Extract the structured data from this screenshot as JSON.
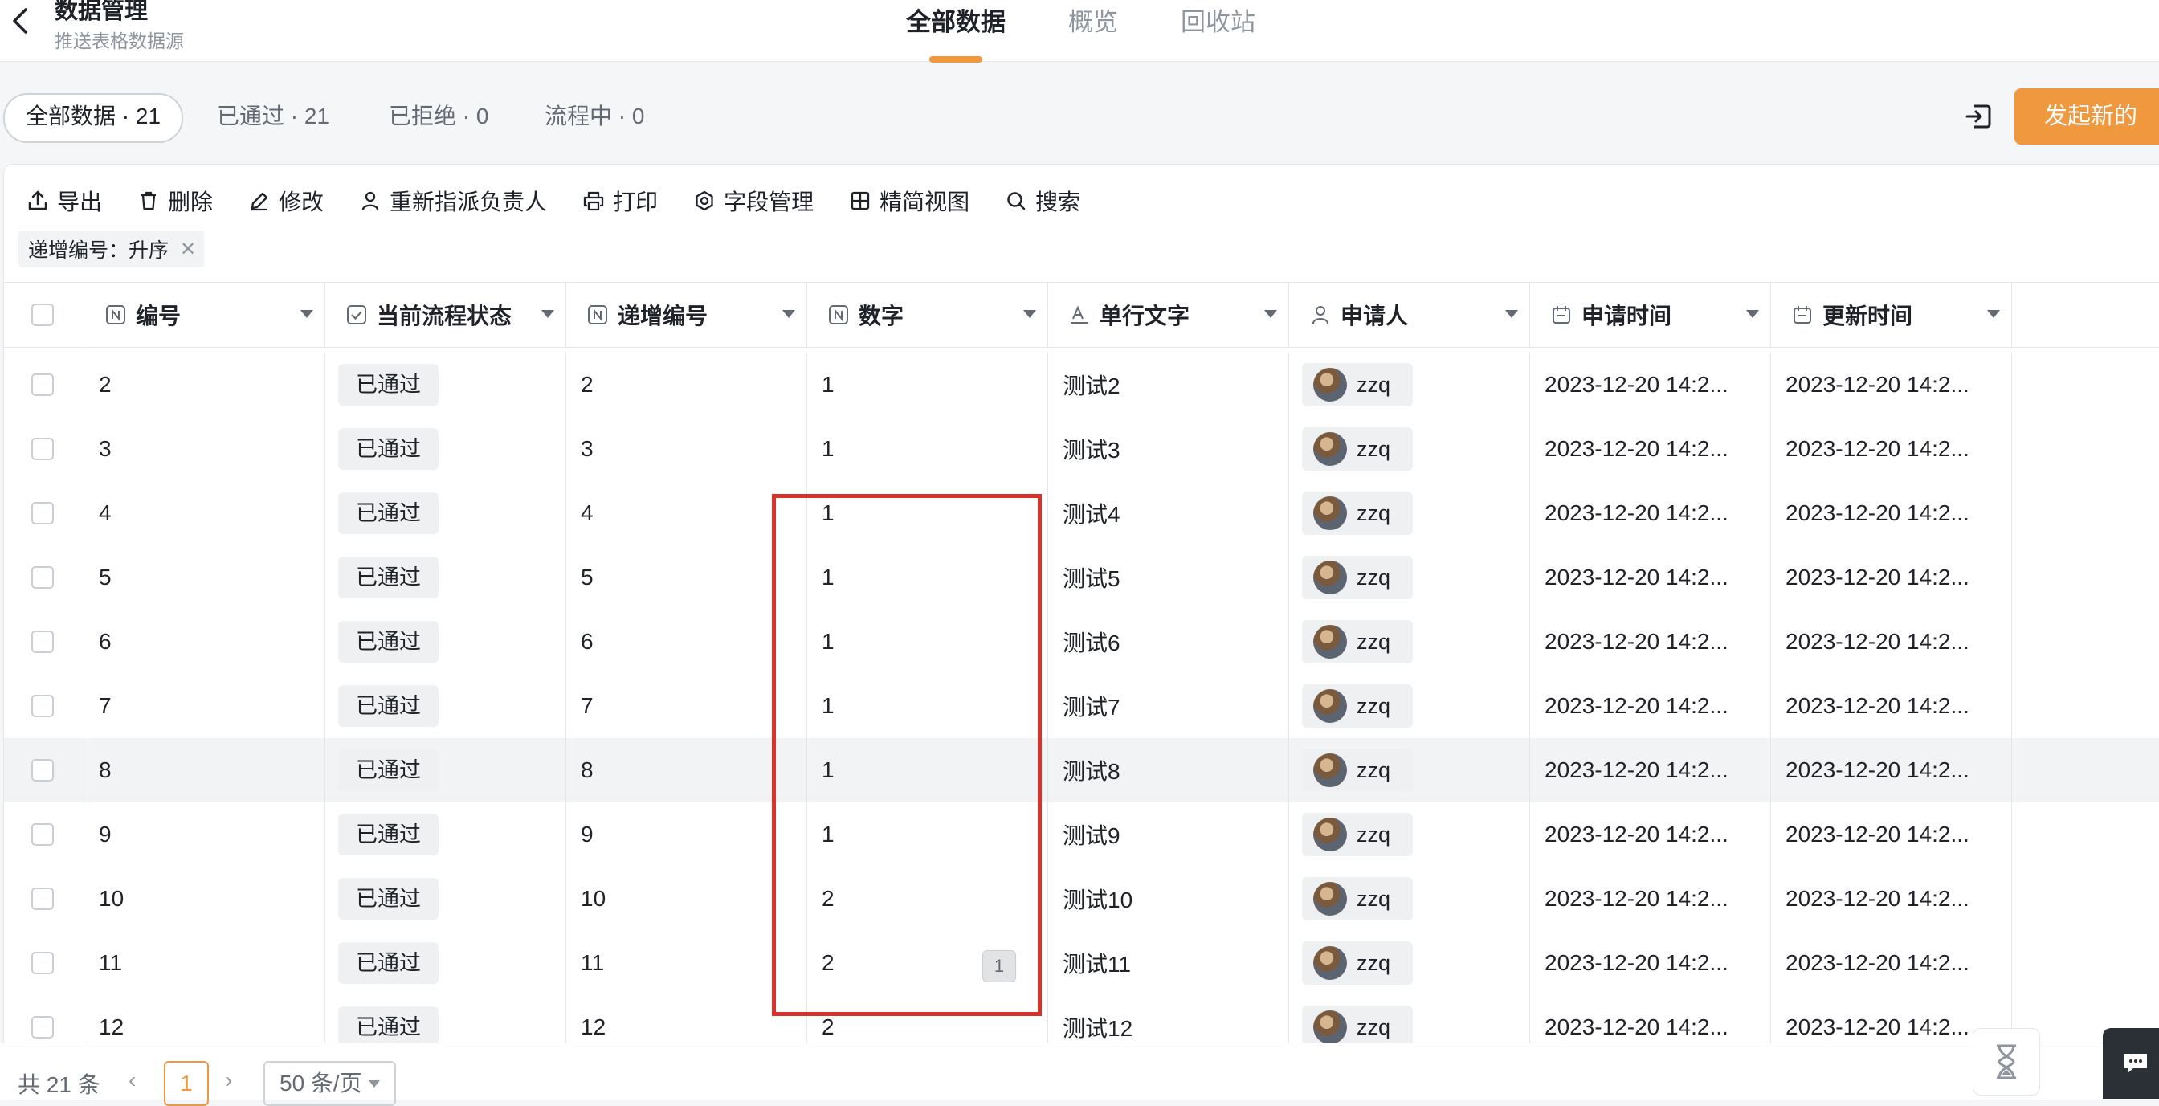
{
  "header": {
    "title": "数据管理",
    "subtitle": "推送表格数据源",
    "tabs": [
      {
        "label": "全部数据",
        "active": true
      },
      {
        "label": "概览",
        "active": false
      },
      {
        "label": "回收站",
        "active": false
      }
    ]
  },
  "filters": {
    "all": "全部数据 · 21",
    "approved": "已通过 · 21",
    "rejected": "已拒绝 · 0",
    "in_progress": "流程中 · 0"
  },
  "new_button": "发起新的",
  "toolbar": {
    "export": "导出",
    "delete": "删除",
    "edit": "修改",
    "reassign": "重新指派负责人",
    "print": "打印",
    "fields": "字段管理",
    "compact_view": "精简视图",
    "search": "搜索"
  },
  "sort_tag": "递增编号：升序",
  "columns": {
    "id": "编号",
    "status": "当前流程状态",
    "seq": "递增编号",
    "number": "数字",
    "text": "单行文字",
    "applicant": "申请人",
    "apply_time": "申请时间",
    "update_time": "更新时间"
  },
  "rows": [
    {
      "id": "2",
      "status": "已通过",
      "seq": "2",
      "number": "1",
      "text": "测试2",
      "applicant": "zzq",
      "apply_time": "2023-12-20 14:2...",
      "update_time": "2023-12-20 14:2..."
    },
    {
      "id": "3",
      "status": "已通过",
      "seq": "3",
      "number": "1",
      "text": "测试3",
      "applicant": "zzq",
      "apply_time": "2023-12-20 14:2...",
      "update_time": "2023-12-20 14:2..."
    },
    {
      "id": "4",
      "status": "已通过",
      "seq": "4",
      "number": "1",
      "text": "测试4",
      "applicant": "zzq",
      "apply_time": "2023-12-20 14:2...",
      "update_time": "2023-12-20 14:2..."
    },
    {
      "id": "5",
      "status": "已通过",
      "seq": "5",
      "number": "1",
      "text": "测试5",
      "applicant": "zzq",
      "apply_time": "2023-12-20 14:2...",
      "update_time": "2023-12-20 14:2..."
    },
    {
      "id": "6",
      "status": "已通过",
      "seq": "6",
      "number": "1",
      "text": "测试6",
      "applicant": "zzq",
      "apply_time": "2023-12-20 14:2...",
      "update_time": "2023-12-20 14:2..."
    },
    {
      "id": "7",
      "status": "已通过",
      "seq": "7",
      "number": "1",
      "text": "测试7",
      "applicant": "zzq",
      "apply_time": "2023-12-20 14:2...",
      "update_time": "2023-12-20 14:2..."
    },
    {
      "id": "8",
      "status": "已通过",
      "seq": "8",
      "number": "1",
      "text": "测试8",
      "applicant": "zzq",
      "apply_time": "2023-12-20 14:2...",
      "update_time": "2023-12-20 14:2..."
    },
    {
      "id": "9",
      "status": "已通过",
      "seq": "9",
      "number": "1",
      "text": "测试9",
      "applicant": "zzq",
      "apply_time": "2023-12-20 14:2...",
      "update_time": "2023-12-20 14:2..."
    },
    {
      "id": "10",
      "status": "已通过",
      "seq": "10",
      "number": "2",
      "text": "测试10",
      "applicant": "zzq",
      "apply_time": "2023-12-20 14:2...",
      "update_time": "2023-12-20 14:2..."
    },
    {
      "id": "11",
      "status": "已通过",
      "seq": "11",
      "number": "2",
      "text": "测试11",
      "applicant": "zzq",
      "apply_time": "2023-12-20 14:2...",
      "update_time": "2023-12-20 14:2..."
    },
    {
      "id": "12",
      "status": "已通过",
      "seq": "12",
      "number": "2",
      "text": "测试12",
      "applicant": "zzq",
      "apply_time": "2023-12-20 14:2...",
      "update_time": "2023-12-20 14:2..."
    }
  ],
  "tooltip_value": "1",
  "footer": {
    "total": "共 21 条",
    "prev": "‹",
    "current_page": "1",
    "next": "›",
    "page_size": "50 条/页"
  },
  "colors": {
    "accent": "#f0983d",
    "highlight": "#d9322b"
  }
}
